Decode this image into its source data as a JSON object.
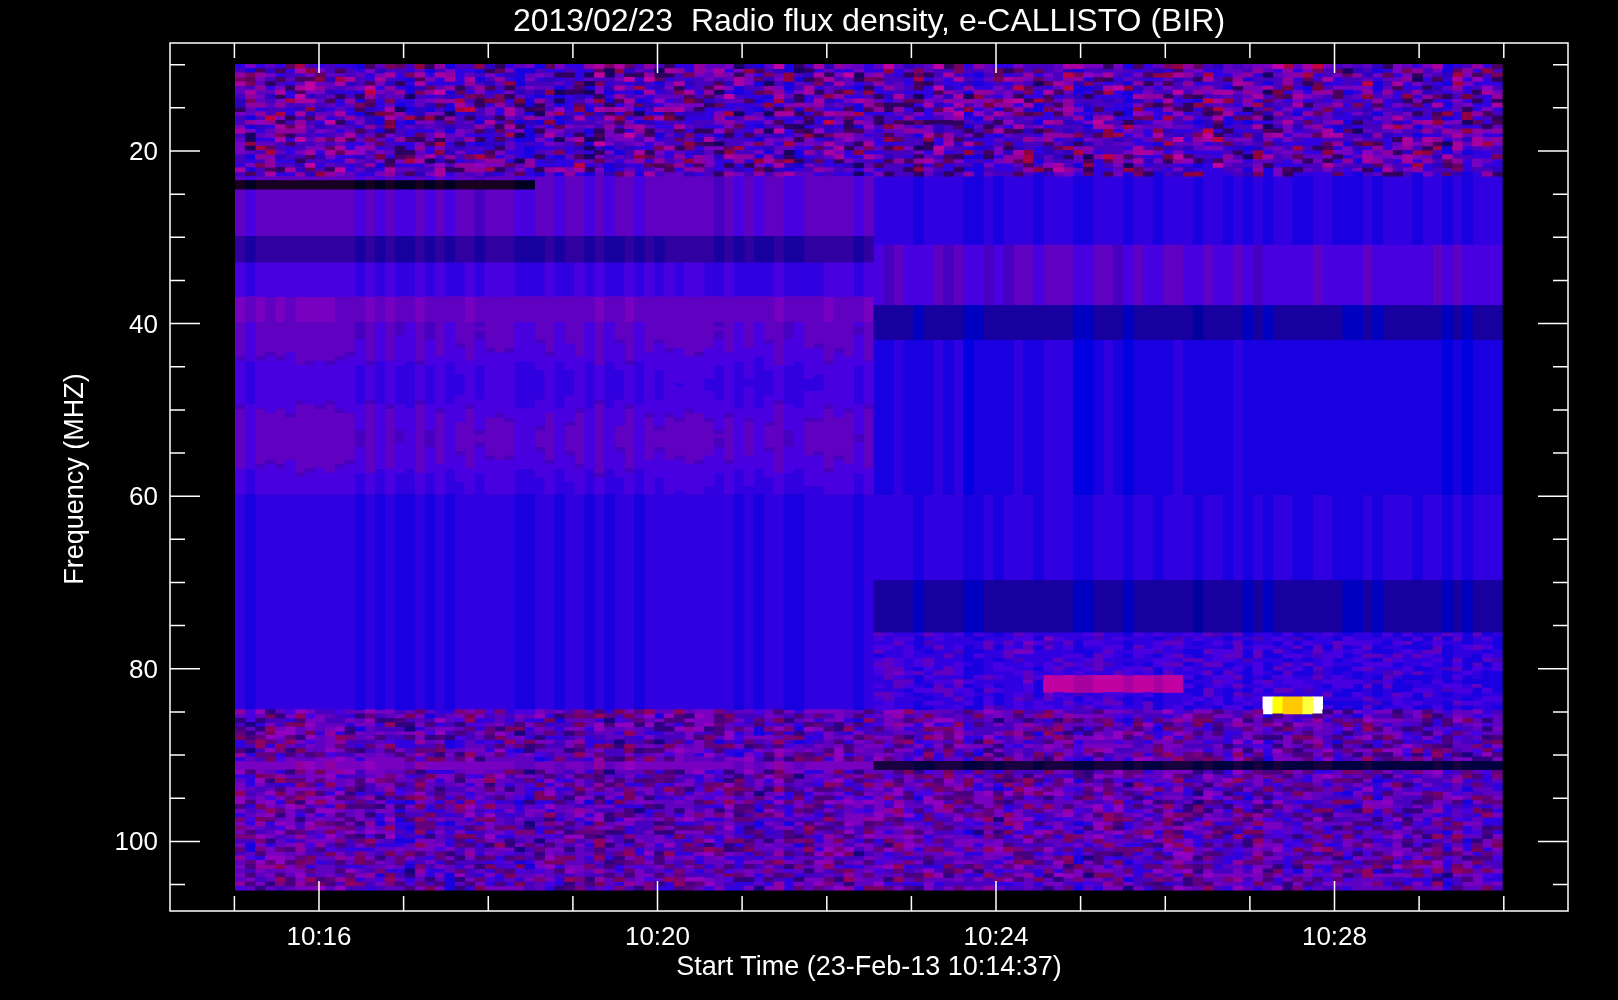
{
  "title": "2013/02/23  Radio flux density, e-CALLISTO (BIR)",
  "plot": {
    "y_axis": {
      "label": "Frequency (MHZ)",
      "ticks": [
        "20",
        "40",
        "60",
        "80",
        "100"
      ]
    },
    "x_axis": {
      "label": "Start Time (23-Feb-13 10:14:37)",
      "ticks": [
        "10:16",
        "10:20",
        "10:24",
        "10:28"
      ]
    }
  }
}
